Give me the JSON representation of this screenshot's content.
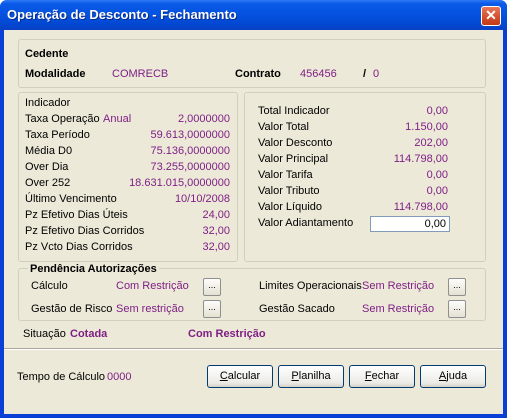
{
  "window": {
    "title": "Operação de Desconto - Fechamento",
    "close_symbol": "✕"
  },
  "cedente": {
    "label": "Cedente",
    "modalidade_label": "Modalidade",
    "modalidade_value": "COMRECB",
    "contrato_label": "Contrato",
    "contrato_value": "456456",
    "contrato_sep": "/",
    "contrato_suffix": "0"
  },
  "indicador": {
    "title": "Indicador",
    "taxa_operacao_label": "Taxa Operação",
    "taxa_operacao_period": "Anual",
    "taxa_operacao_value": "2,0000000",
    "rows": [
      {
        "label": "Taxa Período",
        "value": "59.613,0000000"
      },
      {
        "label": "Média D0",
        "value": "75.136,0000000"
      },
      {
        "label": "Over Dia",
        "value": "73.255,0000000"
      },
      {
        "label": "Over 252",
        "value": "18.631.015,0000000"
      },
      {
        "label": "Último Vencimento",
        "value": "10/10/2008"
      },
      {
        "label": "Pz Efetivo Dias Úteis",
        "value": "24,00"
      },
      {
        "label": "Pz Efetivo Dias Corridos",
        "value": "32,00"
      },
      {
        "label": "Pz Vcto Dias Corridos",
        "value": "32,00"
      }
    ]
  },
  "valores": {
    "rows": [
      {
        "label": "Total Indicador",
        "value": "0,00"
      },
      {
        "label": "Valor Total",
        "value": "1.150,00"
      },
      {
        "label": "Valor Desconto",
        "value": "202,00"
      },
      {
        "label": "Valor Principal",
        "value": "114.798,00"
      },
      {
        "label": "Valor Tarifa",
        "value": "0,00"
      },
      {
        "label": "Valor Tributo",
        "value": "0,00"
      },
      {
        "label": "Valor Líquido",
        "value": "114.798,00"
      }
    ],
    "adiantamento_label": "Valor Adiantamento",
    "adiantamento_value": "0,00"
  },
  "pendencia": {
    "title": "Pendência Autorizações",
    "calculo_label": "Cálculo",
    "calculo_value": "Com Restrição",
    "gestao_risco_label": "Gestão de Risco",
    "gestao_risco_value": "Sem restrição",
    "limites_label": "Limites Operacionais",
    "limites_value": "Sem Restrição",
    "gestao_sacado_label": "Gestão Sacado",
    "gestao_sacado_value": "Sem Restrição",
    "dots": "..."
  },
  "situacao": {
    "label": "Situação",
    "value": "Cotada",
    "status": "Com Restrição"
  },
  "footer": {
    "tempo_label": "Tempo de Cálculo",
    "tempo_value": "0000",
    "buttons": {
      "calcular_first": "C",
      "calcular_rest": "alcular",
      "planilha_first": "P",
      "planilha_rest": "lanilha",
      "fechar_first": "F",
      "fechar_rest": "echar",
      "ajuda_first": "A",
      "ajuda_rest": "juda"
    }
  },
  "colors": {
    "value_text": "#7f1f86",
    "title_bar": "#0553e0",
    "dialog_bg": "#ece9d8"
  }
}
